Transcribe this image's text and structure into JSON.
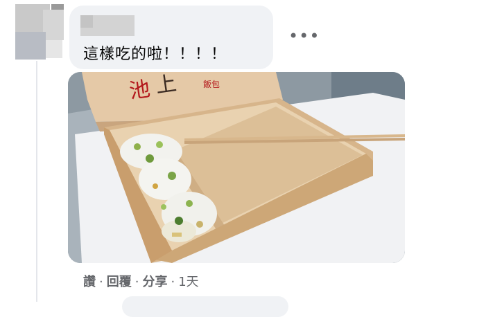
{
  "comment": {
    "text": "這樣吃的啦！！！！",
    "more_icon": "more-horizontal-icon"
  },
  "actions": {
    "like": "讚",
    "reply": "回覆",
    "share": "分享",
    "separator": "·",
    "timestamp": "1天"
  },
  "photo": {
    "box_lid_text": "池上飯包"
  },
  "colors": {
    "bubble_bg": "#f0f2f5",
    "secondary_text": "#65676b",
    "thread_line": "#e4e6eb"
  }
}
